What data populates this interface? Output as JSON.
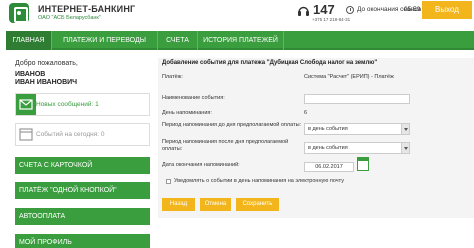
{
  "header": {
    "title": "ИНТЕРНЕТ-БАНКИНГ",
    "subtitle": "ОАО \"АСБ Беларусбанк\"",
    "phone": "147",
    "phone_sub": "+375 17 218-84-31",
    "session_label": "До окончания сеанса",
    "session_time": "05:59",
    "exit_label": "Выход"
  },
  "nav": {
    "items": [
      {
        "label": "ГЛАВНАЯ"
      },
      {
        "label": "ПЛАТЕЖИ И ПЕРЕВОДЫ"
      },
      {
        "label": "СЧЕТА"
      },
      {
        "label": "ИСТОРИЯ ПЛАТЕЖЕЙ"
      }
    ]
  },
  "sidebar": {
    "welcome": "Добро пожаловать,",
    "surname": "ИВАНОВ",
    "name": "ИВАН ИВАНОВИЧ",
    "messages": "Новых сообщений: 1",
    "events": "Событий на сегодня: 0",
    "buttons": [
      {
        "label": "СЧЕТА С КАРТОЧКОЙ"
      },
      {
        "label": "ПЛАТЁЖ \"ОДНОЙ КНОПКОЙ\""
      },
      {
        "label": "АВТООПЛАТА"
      },
      {
        "label": "МОЙ ПРОФИЛЬ"
      }
    ]
  },
  "form": {
    "title": "Добавление события для платежа \"Дубицкая Слобода налог на землю\"",
    "payment_label": "Платёж:",
    "payment_value": "Система \"Расчет\" (ЕРИП) - Платёж",
    "event_name_label": "Наименование события:",
    "reminder_day_label": "День напоминания:",
    "reminder_day_value": "6",
    "period_before_label": "Период напоминания до дня предполагаемой оплаты:",
    "period_before_value": "в день события",
    "period_after_label": "Период напоминания после дня предполагаемой оплаты:",
    "period_after_value": "в день события",
    "end_date_label": "Дата окончания напоминаний:",
    "end_date_value": "06.02.2017",
    "notify_label": "Уведомлять о событии в день напоминания на электронную почту",
    "back_label": "Назад",
    "cancel_label": "Отмена",
    "save_label": "Сохранить"
  },
  "colors": {
    "brand_green": "#3a9d3e",
    "accent_yellow": "#f2b51b"
  }
}
